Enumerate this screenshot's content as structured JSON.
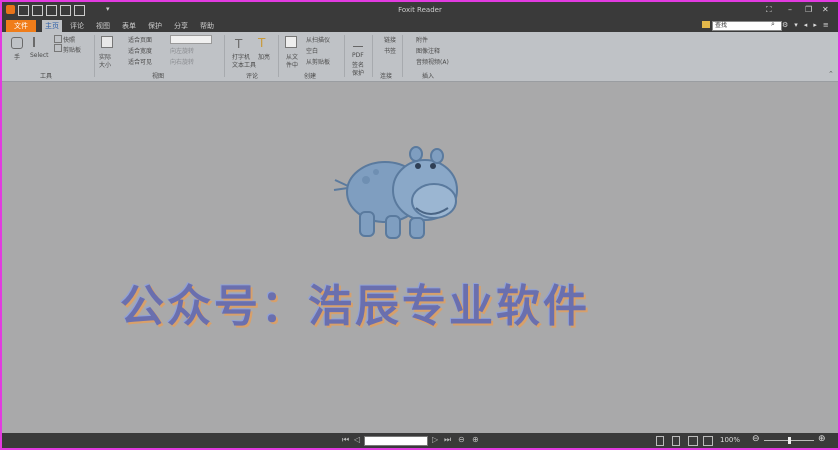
{
  "window": {
    "title": "Foxit Reader",
    "menu_glyph": "≡"
  },
  "tabs": [
    {
      "label": "文件",
      "active": false
    },
    {
      "label": "主页",
      "active": true
    },
    {
      "label": "评论",
      "active": false
    },
    {
      "label": "视图",
      "active": false
    },
    {
      "label": "表单",
      "active": false
    },
    {
      "label": "保护",
      "active": false
    },
    {
      "label": "分享",
      "active": false
    },
    {
      "label": "帮助",
      "active": false
    }
  ],
  "search": {
    "placeholder": "查找"
  },
  "ribbon": {
    "tools": {
      "hand": "手",
      "select": "Select",
      "snapshot": "快照",
      "clipboard": "剪贴板",
      "group": "工具"
    },
    "view": {
      "actual_size": "实际",
      "actual_size2": "大小",
      "fit_page": "适合页面",
      "fit_width": "适合宽度",
      "fit_visible": "适合可见",
      "rotate_left": "向左旋转",
      "rotate_right": "向右旋转",
      "group": "视图"
    },
    "comment": {
      "typewriter": "打字机",
      "typewriter2": "文本工具",
      "highlight": "加亮",
      "group": "评论"
    },
    "create": {
      "from_file": "从文",
      "from_file2": "件中",
      "from_scanner": "从扫描仪",
      "blank": "空白",
      "from_clipboard": "从剪贴板",
      "group": "创建"
    },
    "protect": {
      "pdf_sign": "PDF",
      "pdf_sign2": "签名",
      "pdf_sign3": "保护"
    },
    "links": {
      "link": "链接",
      "bookmark": "书签",
      "group": "连接"
    },
    "insert": {
      "attach": "附件",
      "image_annot": "图像注释",
      "audio_video": "音频视频(A)",
      "group": "插入"
    }
  },
  "document": {
    "watermark": "公众号：浩辰专业软件"
  },
  "status": {
    "zoom": "100%"
  },
  "colors": {
    "file_tab": "#f07d1a",
    "frame_border": "#e23be0",
    "ribbon_bg": "#bfc2c6",
    "canvas_bg": "#a9a9aa"
  }
}
